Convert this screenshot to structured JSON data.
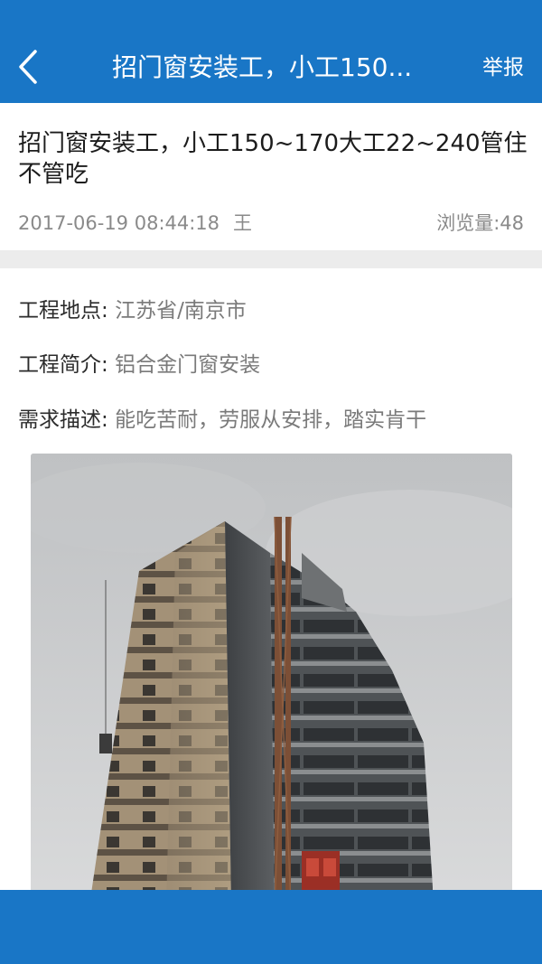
{
  "header": {
    "title": "招门窗安装工，小工150...",
    "report_label": "举报",
    "back_icon": "chevron-left-icon"
  },
  "post": {
    "title": "招门窗安装工，小工150~170大工22~240管住不管吃",
    "date": "2017-06-19 08:44:18",
    "author": "王",
    "views": "浏览量:48"
  },
  "details": {
    "location_label": "工程地点:",
    "location_value": "江苏省/南京市",
    "summary_label": "工程简介:",
    "summary_value": "铝合金门窗安装",
    "requirement_label": "需求描述:",
    "requirement_value": "能吃苦耐，劳服从安排，踏实肯干"
  },
  "colors": {
    "primary": "#1976c6",
    "divider": "#ececec",
    "meta_text": "#8a8a8a"
  }
}
